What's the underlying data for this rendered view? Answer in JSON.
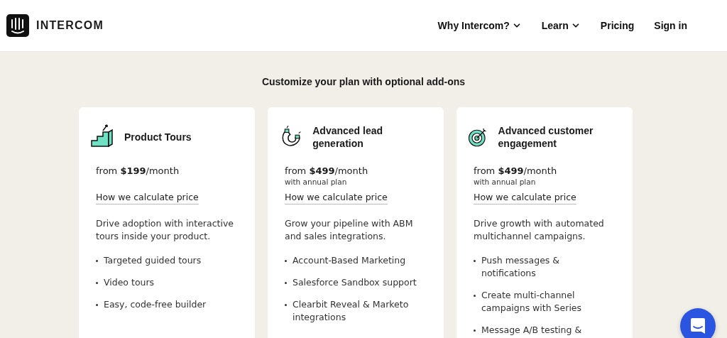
{
  "header": {
    "logo_text": "INTERCOM",
    "nav": [
      {
        "label": "Why Intercom?",
        "dropdown": true
      },
      {
        "label": "Learn",
        "dropdown": true
      },
      {
        "label": "Pricing",
        "dropdown": false
      },
      {
        "label": "Sign in",
        "dropdown": false
      }
    ]
  },
  "section": {
    "title": "Customize your plan with optional add-ons",
    "cards": [
      {
        "kind": "stairs",
        "title": "Product Tours",
        "price": "from **$199**/month",
        "link": "How we calculate price",
        "description": "Drive adoption with interactive tours inside your product.",
        "features": [
          "Targeted guided tours",
          "Video tours",
          "Easy, code-free builder"
        ]
      },
      {
        "kind": "magnet",
        "title": "Advanced lead generation",
        "price": "from **$499**/month",
        "price_note": "with annual plan",
        "link": "How we calculate price",
        "description": "Grow your pipeline with ABM and sales integrations.",
        "features": [
          "Account-Based Marketing",
          "Salesforce Sandbox support",
          "Clearbit Reveal & Marketo integrations"
        ]
      },
      {
        "kind": "target",
        "title": "Advanced customer engagement",
        "price": "from **$499**/month",
        "price_note": "with annual plan",
        "link": "How we calculate price",
        "description": "Drive growth with automated multichannel campaigns.",
        "features": [
          "Push messages & notifications",
          "Create multi-channel campaigns with Series",
          "Message A/B testing &"
        ]
      }
    ]
  }
}
